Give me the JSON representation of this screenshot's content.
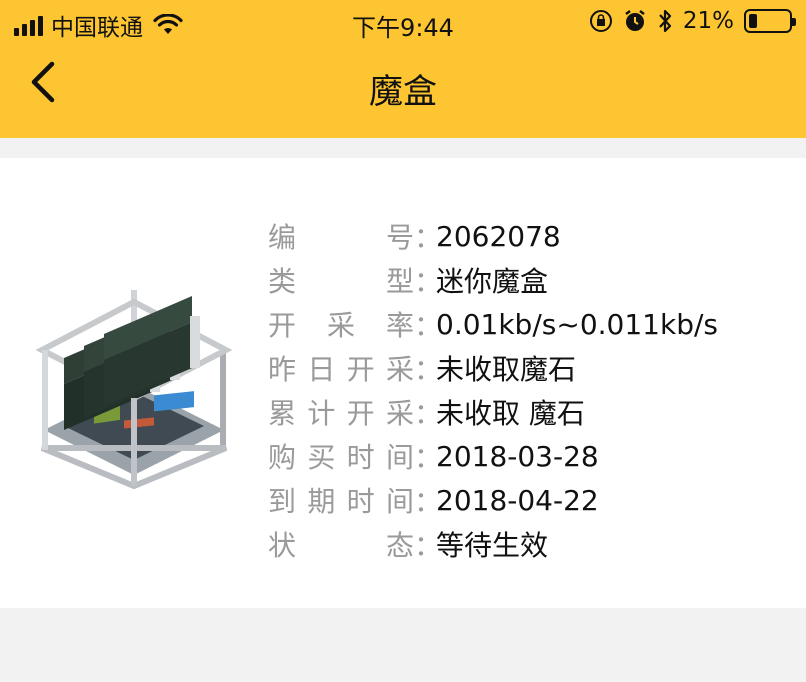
{
  "status_bar": {
    "carrier": "中国联通",
    "time": "下午9:44",
    "battery_percent": "21%",
    "battery_level": 0.21,
    "icons": [
      "signal-icon",
      "wifi-icon",
      "rotation-lock-icon",
      "alarm-icon",
      "bluetooth-icon",
      "battery-icon"
    ]
  },
  "nav": {
    "title": "魔盒",
    "back_icon": "chevron-left-icon"
  },
  "details": {
    "image_icon": "mining-rig-icon",
    "colon": "：",
    "rows": [
      {
        "label": "编号",
        "value": "2062078"
      },
      {
        "label": "类型",
        "value": "迷你魔盒"
      },
      {
        "label": "开采率",
        "value": "0.01kb/s~0.011kb/s"
      },
      {
        "label": "昨日开采",
        "value": "未收取魔石"
      },
      {
        "label": "累计开采",
        "value": "未收取 魔石"
      },
      {
        "label": "购买时间",
        "value": "2018-03-28"
      },
      {
        "label": "到期时间",
        "value": "2018-04-22"
      },
      {
        "label": "状态",
        "value": "等待生效"
      }
    ]
  },
  "colors": {
    "accent": "#fcc531",
    "background": "#f2f2f2",
    "label": "#9a9a9a",
    "value": "#111111"
  }
}
